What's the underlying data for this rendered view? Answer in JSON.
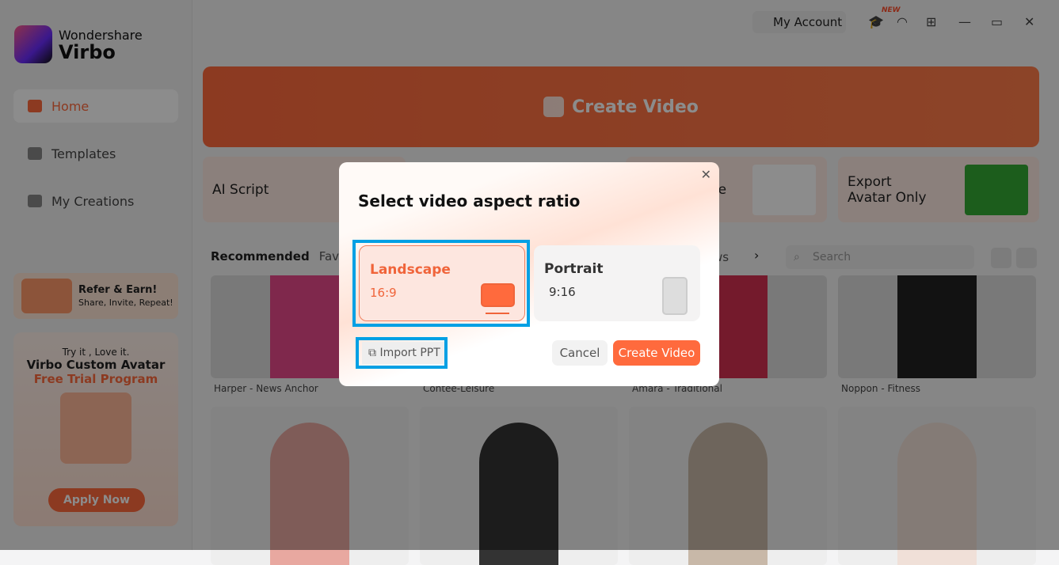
{
  "app": {
    "brand_line1": "Wondershare",
    "brand_line2": "Virbo"
  },
  "sidebar": {
    "items": [
      {
        "label": "Home",
        "active": true
      },
      {
        "label": "Templates"
      },
      {
        "label": "My Creations"
      }
    ],
    "refer": {
      "title": "Refer & Earn!",
      "subtitle": "Share, Invite, Repeat!"
    },
    "promo": {
      "line1": "Try it , Love it.",
      "line2": "Virbo Custom Avatar",
      "line3": "Free Trial Program",
      "button": "Apply Now"
    }
  },
  "topbar": {
    "account": "My Account",
    "new_badge": "NEW"
  },
  "hero": {
    "label": "Create Video"
  },
  "features": [
    {
      "label": "AI Script"
    },
    {
      "label": "te"
    },
    {
      "label": "Export Avatar Only"
    }
  ],
  "tabs": {
    "recommended": "Recommended",
    "partial1": "Favo",
    "partial2": "ws",
    "search_placeholder": "Search"
  },
  "avatars": [
    {
      "name": "Harper - News Anchor"
    },
    {
      "name": "Contee-Leisure"
    },
    {
      "name": "Amara - Traditional"
    },
    {
      "name": "Noppon - Fitness"
    }
  ],
  "dialog": {
    "title": "Select video aspect ratio",
    "options": [
      {
        "label": "Landscape",
        "ratio": "16:9",
        "selected": true
      },
      {
        "label": "Portrait",
        "ratio": "9:16"
      }
    ],
    "import": "Import PPT",
    "cancel": "Cancel",
    "create": "Create Video"
  },
  "colors": {
    "accent": "#ff6a3d",
    "highlight": "#00a0e4"
  }
}
